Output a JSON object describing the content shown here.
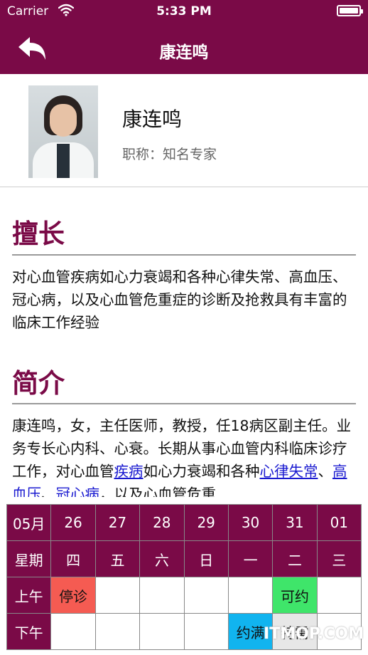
{
  "status_bar": {
    "carrier": "Carrier",
    "time": "5:33 PM"
  },
  "nav": {
    "title": "康连鸣"
  },
  "profile": {
    "name": "康连鸣",
    "title": "职称：知名专家"
  },
  "specialty": {
    "heading": "擅长",
    "text": "对心血管疾病如心力衰竭和各种心律失常、高血压、冠心病，以及心血管危重症的诊断及抢救具有丰富的临床工作经验"
  },
  "intro": {
    "heading": "简介",
    "line1": "康连鸣，女，主任医师，教授，任18病区副主任。业务专长心内科、心衰。长期从事心血管内科临床诊疗工作，对心血管",
    "link1": "疾病",
    "line2": "如心力衰竭和各种",
    "link2": "心律失常",
    "sep1": "、",
    "link3": "高血压",
    "sep2": "、",
    "link4": "冠心病",
    "line3": "，以及心血管危重"
  },
  "schedule": {
    "month_label": "05月",
    "dates": [
      "26",
      "27",
      "28",
      "29",
      "30",
      "31",
      "01"
    ],
    "weekday_label": "星期",
    "weekdays": [
      "四",
      "五",
      "六",
      "日",
      "一",
      "二",
      "三"
    ],
    "am_label": "上午",
    "pm_label": "下午",
    "am": [
      "停诊",
      "",
      "",
      "",
      "",
      "可约",
      ""
    ],
    "pm": [
      "",
      "",
      "",
      "",
      "约满",
      "特需",
      ""
    ],
    "colors": {
      "stop": "#f55b52",
      "available": "#3fe56a",
      "full": "#11b4ef",
      "special": "#e7e7e7",
      "header": "#7a0a47"
    }
  },
  "watermark": "ITMOP.COM",
  "icons": {
    "back": "back-arrow-icon",
    "wifi": "wifi-icon",
    "battery": "battery-icon"
  }
}
